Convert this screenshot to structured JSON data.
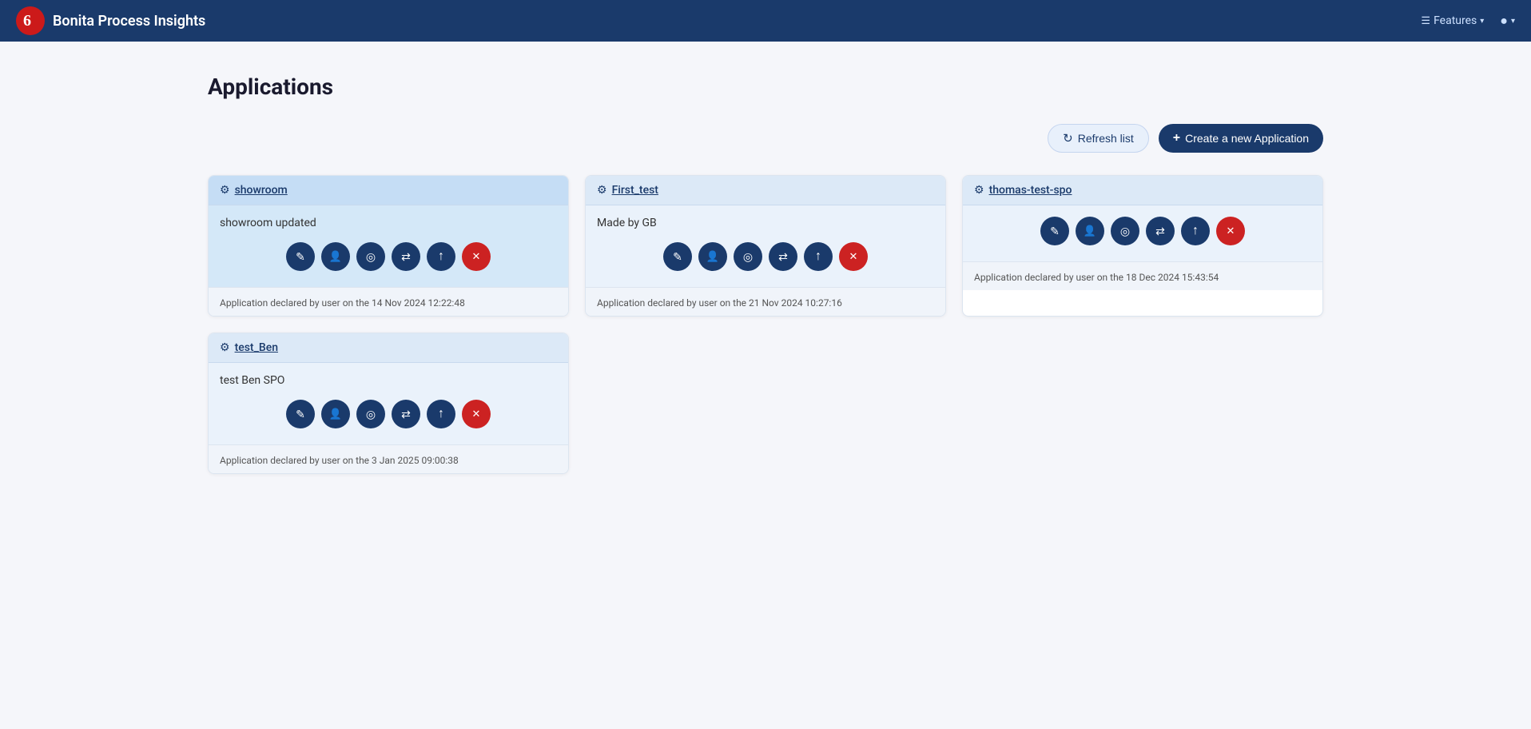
{
  "navbar": {
    "brand": "Bonita Process Insights",
    "features_label": "Features",
    "user_label": ""
  },
  "page": {
    "title": "Applications"
  },
  "toolbar": {
    "refresh_label": "Refresh list",
    "create_label": "Create a new Application"
  },
  "applications": [
    {
      "id": "showroom",
      "name": "showroom",
      "description": "showroom updated",
      "footer": "Application declared by user on the 14 Nov 2024 12:22:48",
      "highlighted": true
    },
    {
      "id": "first_test",
      "name": "First_test",
      "description": "Made by GB",
      "footer": "Application declared by user on the 21 Nov 2024 10:27:16",
      "highlighted": false
    },
    {
      "id": "thomas-test-spo",
      "name": "thomas-test-spo",
      "description": "",
      "footer": "Application declared by user on the 18 Dec 2024 15:43:54",
      "highlighted": false
    },
    {
      "id": "test_ben",
      "name": "test_Ben",
      "description": "test Ben SPO",
      "footer": "Application declared by user on the 3 Jan 2025 09:00:38",
      "highlighted": false
    }
  ],
  "action_buttons": [
    {
      "icon": "pencil",
      "label": "Edit",
      "color": "blue"
    },
    {
      "icon": "user",
      "label": "Users",
      "color": "blue"
    },
    {
      "icon": "target",
      "label": "Target",
      "color": "blue"
    },
    {
      "icon": "arrows",
      "label": "Links",
      "color": "blue"
    },
    {
      "icon": "upload",
      "label": "Export",
      "color": "blue"
    },
    {
      "icon": "close",
      "label": "Delete",
      "color": "red"
    }
  ]
}
